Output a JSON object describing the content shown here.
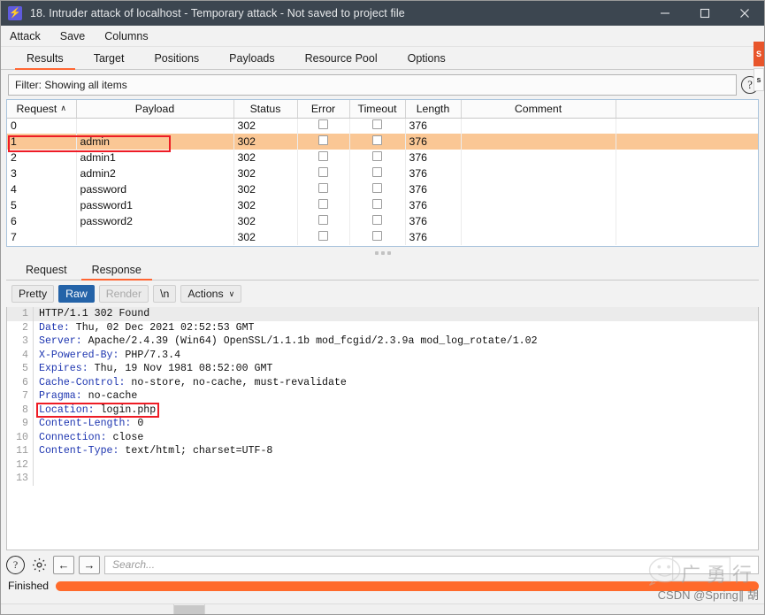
{
  "window": {
    "title": "18. Intruder attack of localhost - Temporary attack - Not saved to project file",
    "icon": "burp-lightning-icon",
    "minimize": "—",
    "maximize": "□",
    "close": "✕"
  },
  "menubar": {
    "items": [
      {
        "label": "Attack"
      },
      {
        "label": "Save"
      },
      {
        "label": "Columns"
      }
    ]
  },
  "tabs": {
    "items": [
      {
        "label": "Results",
        "active": true
      },
      {
        "label": "Target",
        "active": false
      },
      {
        "label": "Positions",
        "active": false
      },
      {
        "label": "Payloads",
        "active": false
      },
      {
        "label": "Resource Pool",
        "active": false
      },
      {
        "label": "Options",
        "active": false
      }
    ]
  },
  "filter": {
    "text": "Filter: Showing all items",
    "help_icon": "question-mark-icon",
    "help_label": "?"
  },
  "results_table": {
    "columns": [
      {
        "label": "Request",
        "sort": "∧"
      },
      {
        "label": "Payload"
      },
      {
        "label": "Status"
      },
      {
        "label": "Error"
      },
      {
        "label": "Timeout"
      },
      {
        "label": "Length"
      },
      {
        "label": "Comment"
      },
      {
        "label": ""
      }
    ],
    "rows": [
      {
        "request": "0",
        "payload": "",
        "status": "302",
        "error": false,
        "timeout": false,
        "length": "376",
        "comment": "",
        "selected": false
      },
      {
        "request": "1",
        "payload": "admin",
        "status": "302",
        "error": false,
        "timeout": false,
        "length": "376",
        "comment": "",
        "selected": true
      },
      {
        "request": "2",
        "payload": "admin1",
        "status": "302",
        "error": false,
        "timeout": false,
        "length": "376",
        "comment": "",
        "selected": false
      },
      {
        "request": "3",
        "payload": "admin2",
        "status": "302",
        "error": false,
        "timeout": false,
        "length": "376",
        "comment": "",
        "selected": false
      },
      {
        "request": "4",
        "payload": "password",
        "status": "302",
        "error": false,
        "timeout": false,
        "length": "376",
        "comment": "",
        "selected": false
      },
      {
        "request": "5",
        "payload": "password1",
        "status": "302",
        "error": false,
        "timeout": false,
        "length": "376",
        "comment": "",
        "selected": false
      },
      {
        "request": "6",
        "payload": "password2",
        "status": "302",
        "error": false,
        "timeout": false,
        "length": "376",
        "comment": "",
        "selected": false
      },
      {
        "request": "7",
        "payload": "",
        "status": "302",
        "error": false,
        "timeout": false,
        "length": "376",
        "comment": "",
        "selected": false
      }
    ]
  },
  "message_tabs": {
    "items": [
      {
        "label": "Request",
        "active": false
      },
      {
        "label": "Response",
        "active": true
      }
    ]
  },
  "message_toolbar": {
    "buttons": [
      {
        "label": "Pretty",
        "state": "normal"
      },
      {
        "label": "Raw",
        "state": "selected"
      },
      {
        "label": "Render",
        "state": "disabled"
      },
      {
        "label": "\\n",
        "state": "normal"
      },
      {
        "label": "Actions",
        "state": "normal",
        "caret": "∨"
      }
    ]
  },
  "response": {
    "lines": [
      {
        "n": "1",
        "text": "HTTP/1.1 302 Found",
        "kind": "status"
      },
      {
        "n": "2",
        "key": "Date:",
        "value": " Thu, 02 Dec 2021 02:52:53 GMT",
        "kind": "header"
      },
      {
        "n": "3",
        "key": "Server:",
        "value": " Apache/2.4.39 (Win64) OpenSSL/1.1.1b mod_fcgid/2.3.9a mod_log_rotate/1.02",
        "kind": "header"
      },
      {
        "n": "4",
        "key": "X-Powered-By:",
        "value": " PHP/7.3.4",
        "kind": "header"
      },
      {
        "n": "5",
        "key": "Expires:",
        "value": " Thu, 19 Nov 1981 08:52:00 GMT",
        "kind": "header"
      },
      {
        "n": "6",
        "key": "Cache-Control:",
        "value": " no-store, no-cache, must-revalidate",
        "kind": "header"
      },
      {
        "n": "7",
        "key": "Pragma:",
        "value": " no-cache",
        "kind": "header"
      },
      {
        "n": "8",
        "key": "Location:",
        "value": " login.php",
        "kind": "header",
        "highlighted": true
      },
      {
        "n": "9",
        "key": "Content-Length:",
        "value": " 0",
        "kind": "header"
      },
      {
        "n": "10",
        "key": "Connection:",
        "value": " close",
        "kind": "header"
      },
      {
        "n": "11",
        "key": "Content-Type:",
        "value": " text/html; charset=UTF-8",
        "kind": "header"
      },
      {
        "n": "12",
        "text": "",
        "kind": "blank"
      },
      {
        "n": "13",
        "text": "",
        "kind": "blank"
      }
    ]
  },
  "bottom_toolbar": {
    "help_icon": "question-mark-icon",
    "help_label": "?",
    "settings_icon": "gear-icon",
    "back_icon": "arrow-left-icon",
    "back_label": "←",
    "forward_icon": "arrow-right-icon",
    "forward_label": "→",
    "search_placeholder": "Search..."
  },
  "status": {
    "label": "Finished",
    "progress_percent": 100,
    "progress_color": "#ff6a2b"
  },
  "side_tabs": [
    {
      "label": "S",
      "accent": true
    },
    {
      "label": "s",
      "accent": false
    }
  ],
  "watermarks": {
    "csdn": "CSDN @Spring∥ 胡",
    "wechat_icon": "wechat-logo-icon",
    "chinese": "广 勇 行"
  },
  "colors": {
    "accent": "#ff6633",
    "titlebar": "#3c4650",
    "selection_row": "#fac795",
    "highlight_border": "#ee1c25",
    "selected_button": "#2463a8",
    "header_key": "#1d35b0"
  }
}
